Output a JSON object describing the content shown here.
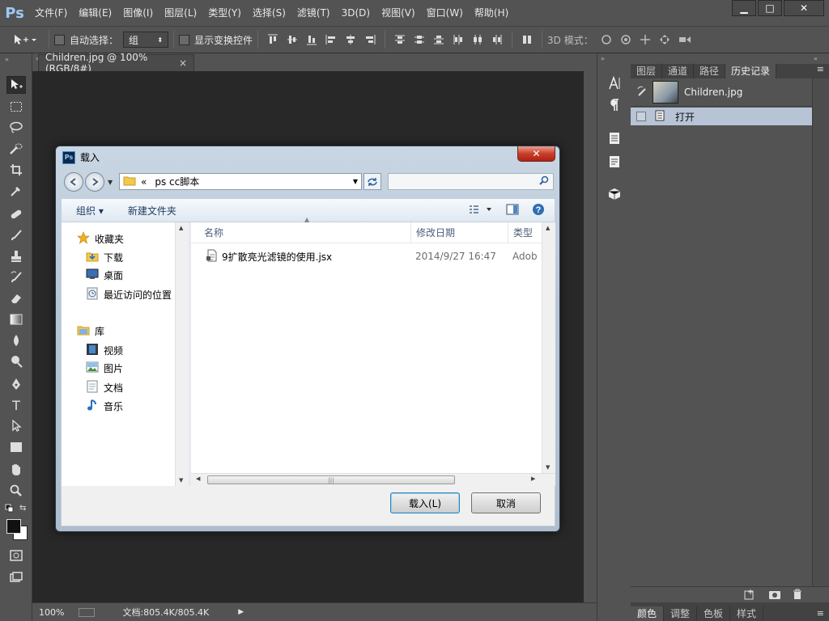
{
  "app": {
    "logo": "Ps"
  },
  "menu": [
    "文件(F)",
    "编辑(E)",
    "图像(I)",
    "图层(L)",
    "类型(Y)",
    "选择(S)",
    "滤镜(T)",
    "3D(D)",
    "视图(V)",
    "窗口(W)",
    "帮助(H)"
  ],
  "window_controls": {
    "minimize": "▁",
    "maximize": "□",
    "close": "✕"
  },
  "options_bar": {
    "auto_select_label": "自动选择：",
    "auto_select_value": "组",
    "show_transform_label": "显示变换控件",
    "mode_3d_label": "3D 模式："
  },
  "document": {
    "tab_title": "Children.jpg @ 100%(RGB/8#)",
    "tab_close": "×",
    "zoom": "100%",
    "doc_info": "文档:805.4K/805.4K"
  },
  "history_panel": {
    "tabs": [
      "图层",
      "通道",
      "路径",
      "历史记录"
    ],
    "active_tab": "历史记录",
    "snapshot_name": "Children.jpg",
    "states": [
      "打开"
    ]
  },
  "bottom_tabs": [
    "颜色",
    "调整",
    "色板",
    "样式"
  ],
  "dialog": {
    "title": "载入",
    "close": "✕",
    "address_prefix": "«",
    "address_path": "ps cc脚本",
    "toolbar": {
      "organize": "组织 ▾",
      "new_folder": "新建文件夹"
    },
    "nav": {
      "favorites": "收藏夹",
      "favorites_items": [
        "下载",
        "桌面",
        "最近访问的位置"
      ],
      "libraries": "库",
      "library_items": [
        "视频",
        "图片",
        "文档",
        "音乐"
      ]
    },
    "columns": {
      "name": "名称",
      "modified": "修改日期",
      "type": "类型"
    },
    "files": [
      {
        "name": "9扩散亮光滤镜的使用.jsx",
        "modified": "2014/9/27 16:47",
        "type": "Adob"
      }
    ],
    "load_button": "载入(L)",
    "cancel_button": "取消"
  },
  "colors": {
    "ps_bg": "#535353",
    "canvas": "#282828",
    "history_selected": "#b6c4d6",
    "ps_logo": "#9cc9f5"
  }
}
